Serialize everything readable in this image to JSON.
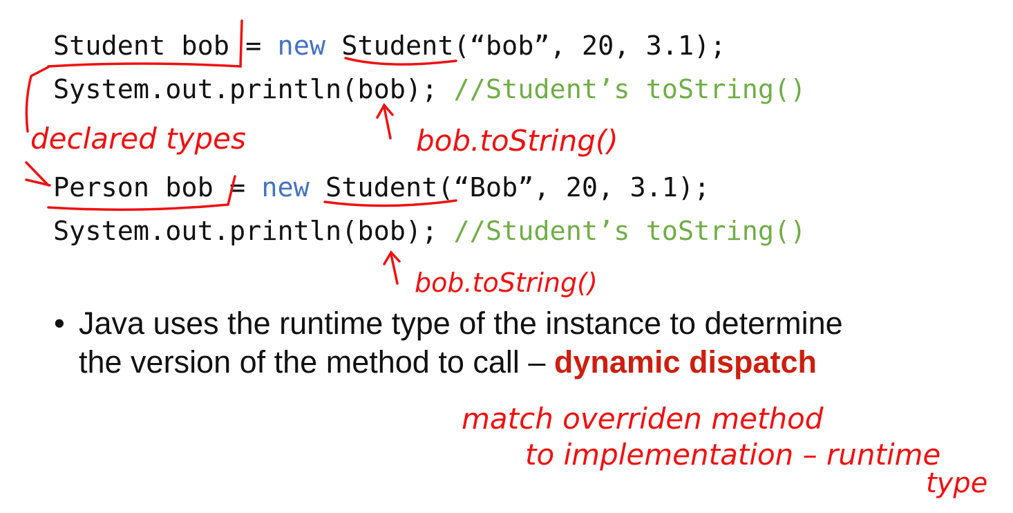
{
  "code_block_1": {
    "line1": {
      "decl": "Student bob",
      "eq": " = ",
      "kw": "new",
      "ctor": " Student(“bob”, 20, 3.1);"
    },
    "line2": {
      "code": "System.out.println(bob); ",
      "comment": "//Student’s toString()"
    }
  },
  "code_block_2": {
    "line1": {
      "decl": "Person bob ",
      "eq": "= ",
      "kw": "new",
      "ctor": " Student(“Bob”, 20, 3.1);"
    },
    "line2": {
      "code": "System.out.println(bob); ",
      "comment": "//Student’s toString()"
    }
  },
  "bullet": {
    "marker": "•",
    "text": "Java uses the runtime type of the instance to determine the version of the method to call – ",
    "highlight": "dynamic dispatch"
  },
  "annotations": {
    "declared_types": "declared types",
    "call_1": "bob.toString()",
    "call_2": "bob.toString()",
    "note_line1": "match overriden method",
    "note_line2": "to implementation – runtime",
    "note_line3": "type"
  },
  "colors": {
    "keyword": "#4472c4",
    "comment": "#70ad47",
    "highlight": "#cc1f0f",
    "ink": "#f01010"
  }
}
